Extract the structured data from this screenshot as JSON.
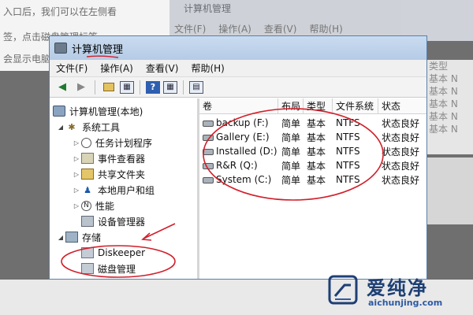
{
  "background": {
    "article_lines": [
      "入口后，我们可以在左侧看",
      "签，点击磁盘管理标签",
      "会显示电脑"
    ],
    "ghost_title": "计算机管理",
    "ghost_menu": [
      "文件(F)",
      "操作(A)",
      "查看(V)",
      "帮助(H)"
    ],
    "ghost_right": [
      "类型",
      "基本",
      "基本",
      "基本",
      "基本",
      "基本"
    ],
    "ghost_right_suffix": [
      "",
      "N",
      "N",
      "N",
      "N",
      "N"
    ]
  },
  "window": {
    "title": "计算机管理",
    "menu": [
      "文件(F)",
      "操作(A)",
      "查看(V)",
      "帮助(H)"
    ],
    "toolbar_icons": [
      "back-arrow-icon",
      "forward-arrow-icon",
      "up-folder-icon",
      "show-hide-tree-icon",
      "help-icon",
      "properties-icon",
      "export-icon"
    ]
  },
  "tree": {
    "root": "计算机管理(本地)",
    "system_tools": "系统工具",
    "system_children": [
      "任务计划程序",
      "事件查看器",
      "共享文件夹",
      "本地用户和组",
      "性能",
      "设备管理器"
    ],
    "storage": "存储",
    "storage_children": [
      "Diskeeper",
      "磁盘管理"
    ]
  },
  "volumes": {
    "columns": [
      "卷",
      "布局",
      "类型",
      "文件系统",
      "状态"
    ],
    "rows": [
      {
        "name": "backup (F:)",
        "layout": "简单",
        "type": "基本",
        "fs": "NTFS",
        "status": "状态良好"
      },
      {
        "name": "Gallery (E:)",
        "layout": "简单",
        "type": "基本",
        "fs": "NTFS",
        "status": "状态良好"
      },
      {
        "name": "Installed (D:)",
        "layout": "简单",
        "type": "基本",
        "fs": "NTFS",
        "status": "状态良好"
      },
      {
        "name": "R&R (Q:)",
        "layout": "简单",
        "type": "基本",
        "fs": "NTFS",
        "status": "状态良好"
      },
      {
        "name": "System (C:)",
        "layout": "简单",
        "type": "基本",
        "fs": "NTFS",
        "status": "状态良好"
      }
    ]
  },
  "annotation_color": "#d21f2a",
  "watermark": {
    "name": "爱纯净",
    "url": "aichunjing.com"
  }
}
